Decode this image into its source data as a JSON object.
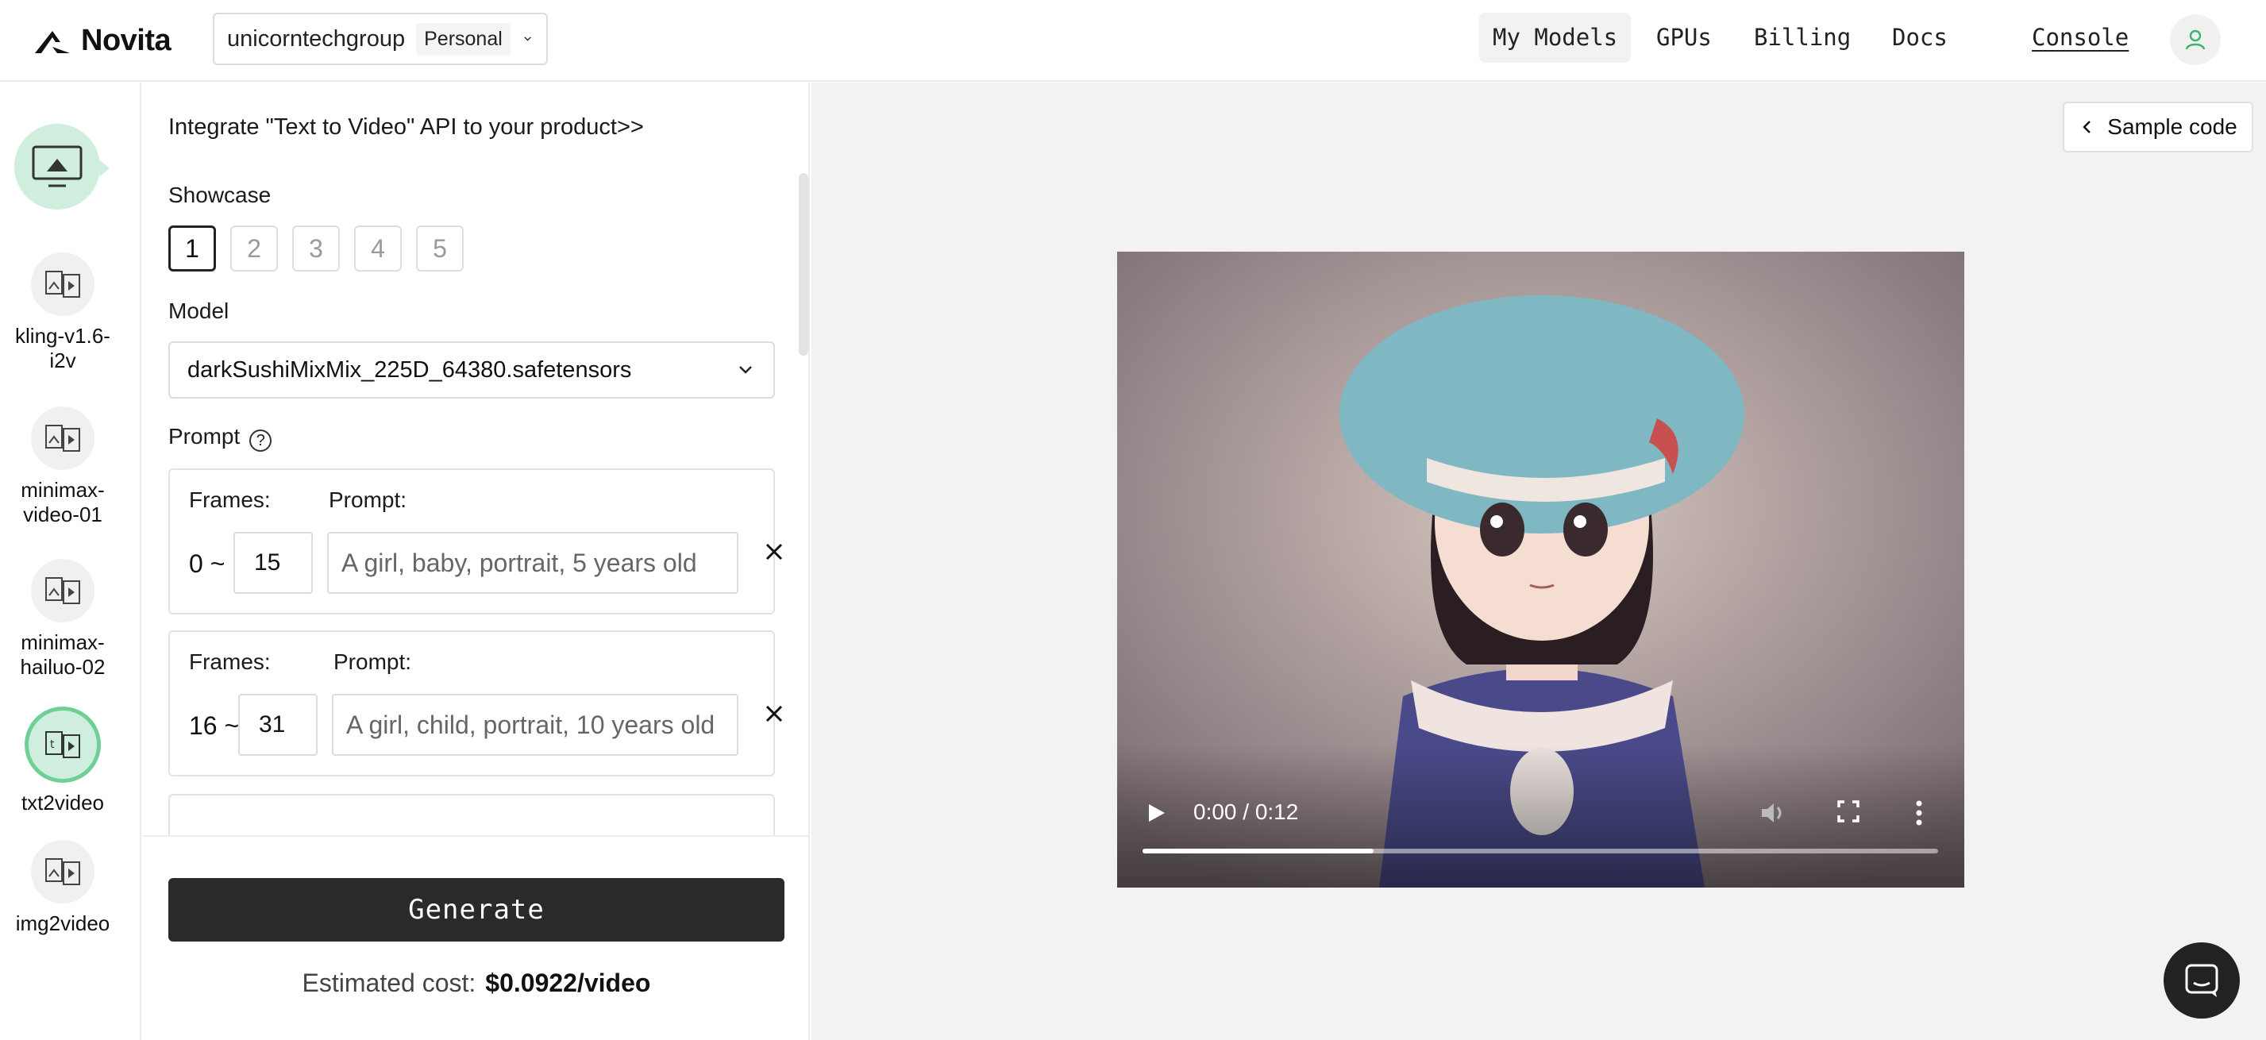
{
  "header": {
    "brand": "Novita",
    "team_name": "unicorntechgroup",
    "team_badge": "Personal",
    "nav": [
      {
        "label": "My Models",
        "active": true
      },
      {
        "label": "GPUs",
        "active": false
      },
      {
        "label": "Billing",
        "active": false
      },
      {
        "label": "Docs",
        "active": false
      }
    ],
    "console_label": "Console"
  },
  "rail": {
    "items": [
      {
        "label": "kling-v1.6-i2v",
        "label_lines": [
          "kling-v1.6-",
          "i2v"
        ],
        "active": false
      },
      {
        "label": "minimax-video-01",
        "label_lines": [
          "minimax-",
          "video-01"
        ],
        "active": false
      },
      {
        "label": "minimax-hailuo-02",
        "label_lines": [
          "minimax-",
          "hailuo-02"
        ],
        "active": false
      },
      {
        "label": "txt2video",
        "label_lines": [
          "txt2video"
        ],
        "active": true
      },
      {
        "label": "img2video",
        "label_lines": [
          "img2video"
        ],
        "active": false
      }
    ]
  },
  "form": {
    "integrate_link": "Integrate \"Text to Video\" API to your product>>",
    "showcase_label": "Showcase",
    "showcase_options": [
      "1",
      "2",
      "3",
      "4",
      "5"
    ],
    "showcase_selected": "1",
    "model_label": "Model",
    "model_value": "darkSushiMixMix_225D_64380.safetensors",
    "prompt_label": "Prompt",
    "frames": [
      {
        "frames_label": "Frames:",
        "prompt_label": "Prompt:",
        "start": "0 ~",
        "end": "15",
        "prompt": "A girl, baby, portrait, 5 years old"
      },
      {
        "frames_label": "Frames:",
        "prompt_label": "Prompt:",
        "start": "16 ~",
        "end": "31",
        "prompt": "A girl, child, portrait, 10 years old"
      }
    ],
    "generate_label": "Generate",
    "cost_label": "Estimated cost:",
    "cost_value": "$0.0922/video"
  },
  "preview": {
    "sample_code_label": "Sample code",
    "video": {
      "time": "0:00 / 0:12",
      "progress": 0.29
    }
  },
  "colors": {
    "accent_green": "#6fcf97",
    "accent_green_light": "#cfeedd",
    "dark_button": "#2a2a2a"
  }
}
